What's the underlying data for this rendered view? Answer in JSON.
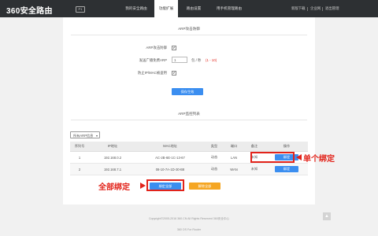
{
  "header": {
    "logo": "360安全路由",
    "logo_badge": "P1",
    "tabs": [
      {
        "label": "我的安全路由"
      },
      {
        "label": "功能扩展"
      },
      {
        "label": "路由设置"
      },
      {
        "label": "用手机管理路由"
      }
    ],
    "links": [
      "新版下载",
      "企业网",
      "退出管理"
    ]
  },
  "arp_defense": {
    "title": "ARP攻击防御",
    "enable_label": "ARP攻击防御",
    "enable_checked": "✔",
    "broadcast_label": "发送广播免费ARP",
    "broadcast_value": "1",
    "broadcast_unit": "包 / 秒",
    "broadcast_range": "(1 - 10)",
    "mac_spoof_label": "防止IP/MAC被盗用",
    "mac_spoof_checked": "✔",
    "save_button": "保存生效"
  },
  "arp_list": {
    "title": "ARP监控列表",
    "filter_selected": "所有ARP信息",
    "columns": [
      "序列号",
      "IP地址",
      "MAC地址",
      "类型",
      "端口",
      "备注",
      "操作"
    ],
    "rows": [
      {
        "index": "1",
        "ip": "192.168.0.2",
        "mac": "AC-2B-6E-1C-13-67",
        "type": "动态",
        "port": "LAN",
        "note": "未知",
        "action": "绑定"
      },
      {
        "index": "2",
        "ip": "192.168.7.1",
        "mac": "08-10-7A-1D-30-B8",
        "type": "动态",
        "port": "WAN",
        "note": "未知",
        "action": "绑定"
      }
    ],
    "bind_all_button": "绑定全部",
    "unbind_all_button": "解除全部"
  },
  "annotations": {
    "single_bind": "单个绑定",
    "all_bind": "全部绑定"
  },
  "footer": {
    "copyright": "Copyright©2005-2016 360.CN All Rights Reserved 360安全中心",
    "version": "360 OS For Router"
  },
  "colors": {
    "topbar": "#2d3033",
    "primary_button": "#3b8ef0",
    "secondary_button": "#f5a623",
    "annotation": "#e2231a"
  }
}
